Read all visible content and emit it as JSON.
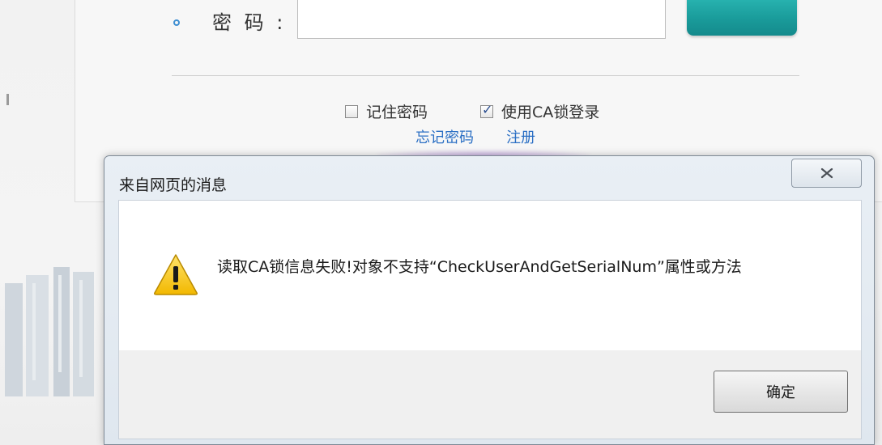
{
  "login": {
    "password_label": "密 码 :",
    "password_value": "",
    "remember_label": "记住密码",
    "remember_checked": false,
    "ca_label": "使用CA锁登录",
    "ca_checked": true,
    "forgot_link": "忘记密码",
    "register_link": "注册"
  },
  "dialog": {
    "title": "来自网页的消息",
    "message": "读取CA锁信息失败!对象不支持“CheckUserAndGetSerialNum”属性或方法",
    "ok_label": "确定",
    "icon": "warning-icon",
    "close_icon": "close-icon"
  },
  "colors": {
    "link": "#2b6fc4",
    "login_button": "#1a9c9b",
    "warning_yellow": "#f6c400"
  }
}
